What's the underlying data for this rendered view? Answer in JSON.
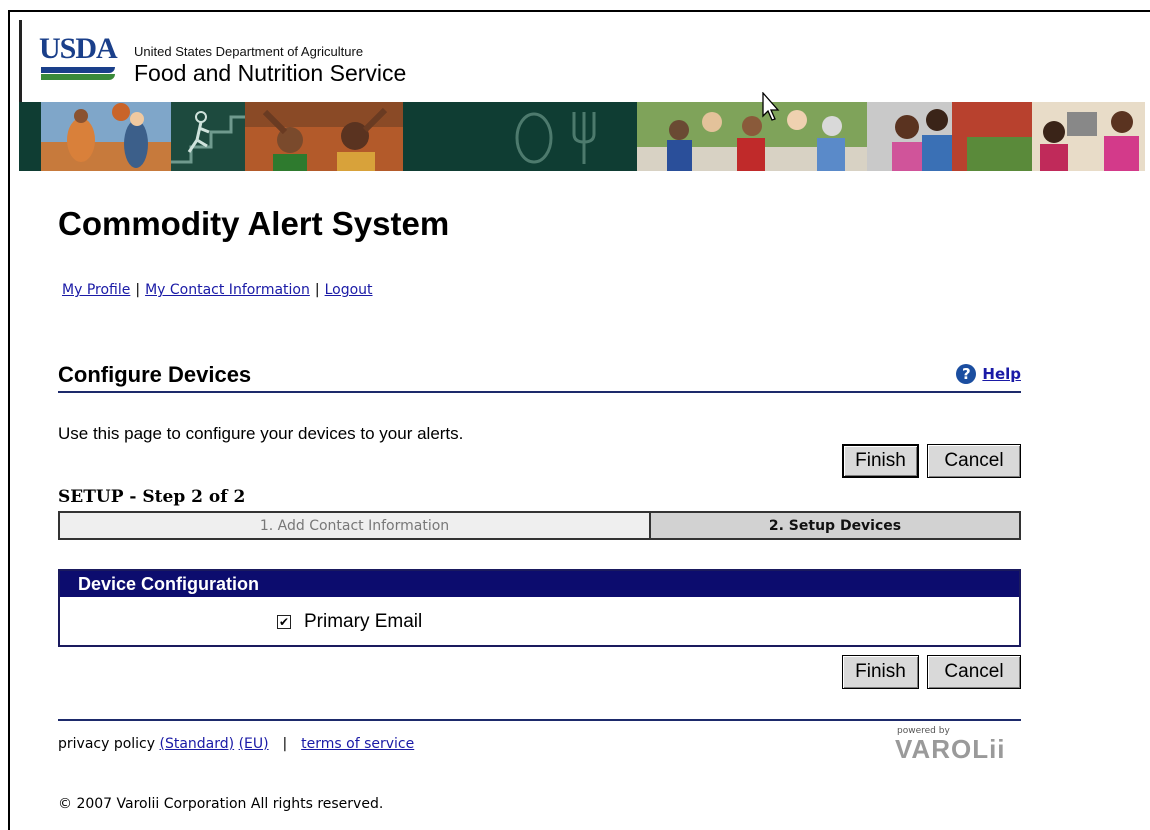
{
  "header": {
    "logo_text": "USDA",
    "department": "United States Department of Agriculture",
    "service": "Food and Nutrition Service"
  },
  "page": {
    "title": "Commodity Alert System"
  },
  "nav": {
    "my_profile": "My Profile",
    "my_contact": "My Contact Information",
    "logout": "Logout",
    "separator": "|"
  },
  "section": {
    "title": "Configure Devices",
    "help": "Help",
    "instructions": "Use this page to configure your devices to your alerts."
  },
  "buttons": {
    "finish": "Finish",
    "cancel": "Cancel"
  },
  "setup": {
    "label": "SETUP - Step 2 of 2",
    "steps": [
      {
        "label": "1. Add Contact Information",
        "active": false
      },
      {
        "label": "2. Setup Devices",
        "active": true
      }
    ]
  },
  "device_config": {
    "header": "Device Configuration",
    "items": [
      {
        "label": "Primary Email",
        "checked": true
      }
    ]
  },
  "footer": {
    "privacy_policy": "privacy policy",
    "standard": "(Standard)",
    "eu": "(EU)",
    "terms": "terms of service",
    "powered_by": "powered by",
    "brand": "VAROLii",
    "copyright": "© 2007 Varolii Corporation All rights reserved."
  },
  "colors": {
    "usda_blue": "#1a3f8a",
    "usda_green": "#3a8a3a",
    "header_bar": "#0c0c6e",
    "rule": "#1d2a6b",
    "link": "#1a1aa6",
    "photo_strip": "#0f3d33"
  }
}
